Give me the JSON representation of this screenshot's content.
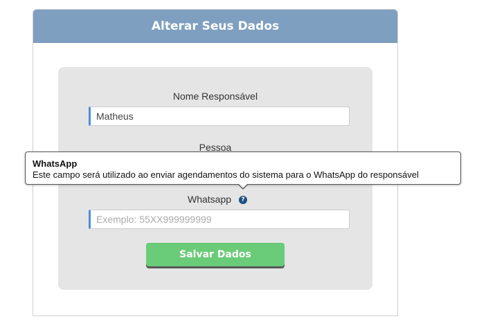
{
  "panel": {
    "title": "Alterar Seus Dados"
  },
  "form": {
    "nome": {
      "label": "Nome Responsável",
      "value": "Matheus"
    },
    "pessoa": {
      "label": "Pessoa"
    },
    "whatsapp": {
      "label": "Whatsapp",
      "placeholder": "Exemplo: 55XX999999999",
      "value": "",
      "help_icon": "question-mark-icon"
    },
    "save_label": "Salvar Dados"
  },
  "tooltip": {
    "title": "WhatsApp",
    "body": "Este campo será utilizado ao enviar agendamentos do sistema para o WhatsApp do responsável"
  },
  "colors": {
    "header": "#7e9fc0",
    "input_accent": "#4a8fdc",
    "save_button": "#6acb78",
    "card_background": "#e5e5e5"
  }
}
